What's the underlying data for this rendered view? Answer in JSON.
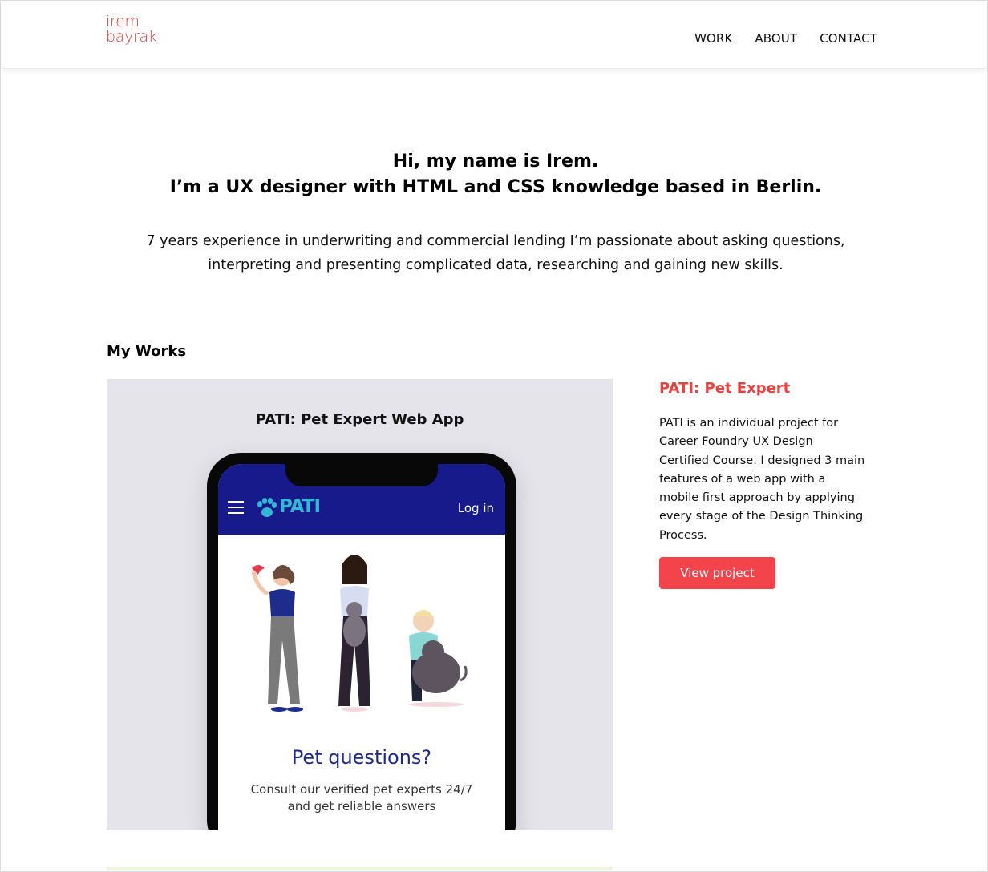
{
  "header": {
    "logo_line1": "irem",
    "logo_line2": "bayrak",
    "nav": [
      "WORK",
      "ABOUT",
      "CONTACT"
    ]
  },
  "hero": {
    "title_line1": "Hi, my name is Irem.",
    "title_line2": "I’m a UX designer with HTML and CSS knowledge based in Berlin.",
    "text_line1": "7 years experience in underwriting and commercial lending I’m passionate about asking questions,",
    "text_line2": "interpreting and presenting complicated data, researching and gaining new skills."
  },
  "works": {
    "heading": "My Works",
    "project": {
      "image_title": "PATI: Pet Expert Web App",
      "app": {
        "logo": "PATI",
        "login": "Log in",
        "heading": "Pet questions?",
        "sub_line1": "Consult our verified pet experts 24/7",
        "sub_line2": "and get reliable answers"
      },
      "title": "PATI: Pet Expert",
      "desc_lines": [
        "PATI is an individual project for",
        "Career Foundry UX Design",
        "Certified Course. I designed 3 main",
        "features of a web app with a",
        "mobile first approach by applying",
        "every stage of the Design Thinking",
        "Process."
      ],
      "button": "View project"
    }
  },
  "colors": {
    "accent": "#f2444a",
    "logo": "#d6403e",
    "app_bar": "#171a8a",
    "app_logo": "#34b7d6"
  }
}
